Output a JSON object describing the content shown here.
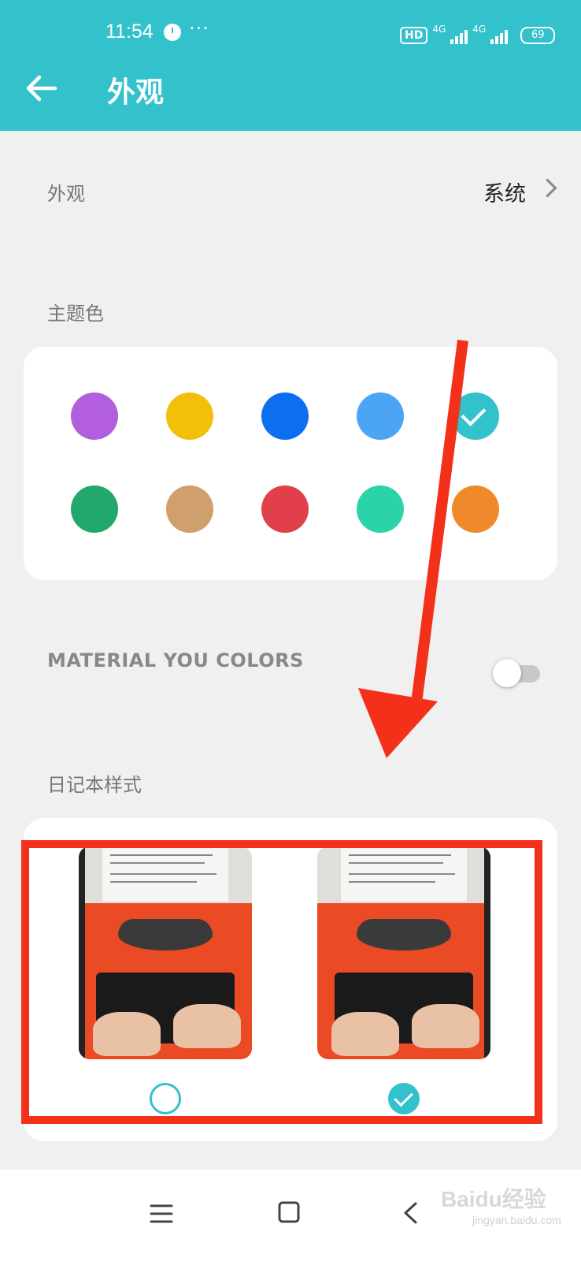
{
  "status_bar": {
    "time": "11:54",
    "dots": "···",
    "hd_badge": "HD",
    "network_1": "4G",
    "network_2": "4G",
    "battery": "69",
    "alarm_icon": "alarm-clock-icon"
  },
  "header": {
    "title": "外观",
    "back_icon": "arrow-left-icon",
    "background": "#33c1cb"
  },
  "appearance_row": {
    "label": "外观",
    "value": "系统"
  },
  "theme_color": {
    "label": "主题色",
    "swatches": [
      {
        "color": "#b35fdd",
        "selected": false
      },
      {
        "color": "#f2bf0b",
        "selected": false
      },
      {
        "color": "#0d6ff0",
        "selected": false
      },
      {
        "color": "#4ca4f5",
        "selected": false
      },
      {
        "color": "#33c1cb",
        "selected": true
      },
      {
        "color": "#21a86a",
        "selected": false
      },
      {
        "color": "#cfa06d",
        "selected": false
      },
      {
        "color": "#e1404a",
        "selected": false
      },
      {
        "color": "#2bd3aa",
        "selected": false
      },
      {
        "color": "#f0892a",
        "selected": false
      }
    ]
  },
  "material_you": {
    "label": "MATERIAL YOU COLORS",
    "enabled": false
  },
  "notebook_style": {
    "label": "日记本样式",
    "options": [
      {
        "image": "typewriter-photo",
        "selected": false
      },
      {
        "image": "typewriter-photo",
        "selected": true
      }
    ]
  },
  "annotation": {
    "arrow_color": "#f3301a",
    "box_color": "#f3301a"
  },
  "nav_bar": {
    "menu_icon": "menu-icon",
    "home_icon": "home-square-icon",
    "back_icon": "back-triangle-icon"
  },
  "watermark": {
    "text": "Baidu经验",
    "sub": "jingyan.baidu.com"
  }
}
